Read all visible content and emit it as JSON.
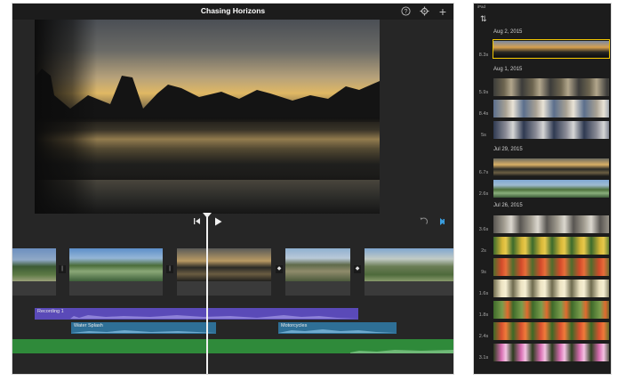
{
  "editor": {
    "title": "Chasing Horizons",
    "help_icon": "help-icon",
    "settings_icon": "gear-icon",
    "add_icon": "plus-icon"
  },
  "audio": {
    "recording_label": "Recording 1",
    "water_label": "Water Splash",
    "motorcycles_label": "Motorcycles",
    "colors": {
      "voiceover": "#5a4ab8",
      "sfx": "#2e6f96",
      "music": "#2f8a3a"
    }
  },
  "browser": {
    "status": "iPad",
    "sort_icon": "sort-icon",
    "groups": [
      {
        "date": "Aug 2, 2015",
        "clips": [
          "8.3s"
        ]
      },
      {
        "date": "Aug 1, 2015",
        "clips": [
          "5.9s",
          "8.4s",
          "5s"
        ]
      },
      {
        "date": "Jul 29, 2015",
        "clips": [
          "6.7s",
          "2.6s"
        ]
      },
      {
        "date": "Jul 26, 2015",
        "clips": [
          "3.6s",
          "2s",
          "9s",
          "1.6s",
          "1.8s",
          "2.4s",
          "3.1s"
        ]
      }
    ]
  },
  "colors": {
    "accent": "#f2c600",
    "background": "#262626"
  }
}
